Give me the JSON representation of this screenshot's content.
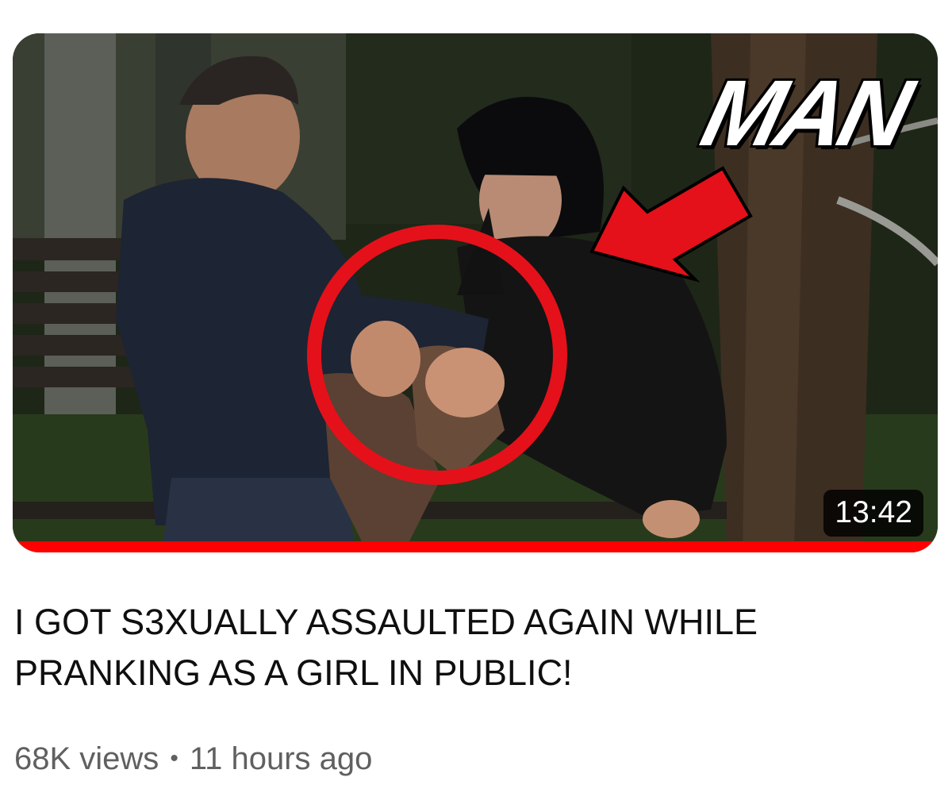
{
  "video": {
    "thumbnail_overlay_text": "MAN",
    "duration": "13:42",
    "watch_progress": 1.0,
    "title": "I GOT S3XUALLY ASSAULTED AGAIN WHILE PRANKING AS A GIRL IN PUBLIC!",
    "views": "68K views",
    "separator": "•",
    "published": "11 hours ago"
  },
  "colors": {
    "progress": "#ff0000",
    "annotation": "#e4111a",
    "title": "#0f0f0f",
    "meta": "#606060"
  }
}
